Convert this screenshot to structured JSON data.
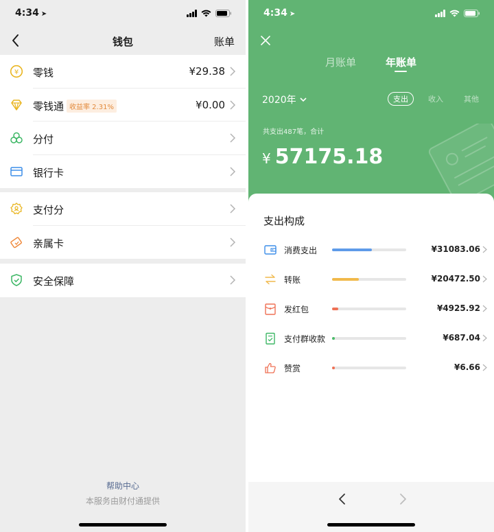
{
  "left": {
    "status": {
      "time": "4:34"
    },
    "header": {
      "title": "钱包",
      "bill": "账单"
    },
    "group1": [
      {
        "label": "零钱",
        "value": "¥29.38"
      },
      {
        "label": "零钱通",
        "badge": "收益率 2.31%",
        "value": "¥0.00"
      },
      {
        "label": "分付",
        "value": ""
      },
      {
        "label": "银行卡",
        "value": ""
      }
    ],
    "group2": [
      {
        "label": "支付分"
      },
      {
        "label": "亲属卡"
      }
    ],
    "group3": [
      {
        "label": "安全保障"
      }
    ],
    "footer": {
      "help": "帮助中心",
      "provider": "本服务由财付通提供"
    },
    "colors": {
      "accent_yellow": "#e9b520",
      "accent_green": "#3db765",
      "accent_blue": "#3c8de8",
      "accent_orange": "#ef8a3c"
    }
  },
  "right": {
    "status": {
      "time": "4:34"
    },
    "tabs": {
      "month": "月账单",
      "year": "年账单"
    },
    "year": "2020年",
    "filters": {
      "expense": "支出",
      "income": "收入",
      "other": "其他"
    },
    "summary": "共支出487笔，合计",
    "total_currency": "¥",
    "total": "57175.18",
    "section_title": "支出构成",
    "categories": [
      {
        "name": "消费支出",
        "amount": "¥31083.06",
        "share": 0.54,
        "color": "#5e9be9",
        "icon": "wallet-icon"
      },
      {
        "name": "转账",
        "amount": "¥20472.50",
        "share": 0.36,
        "color": "#f1b94b",
        "icon": "transfer-icon"
      },
      {
        "name": "发红包",
        "amount": "¥4925.92",
        "share": 0.086,
        "color": "#ef7155",
        "icon": "red-packet-icon"
      },
      {
        "name": "支付群收款",
        "amount": "¥687.04",
        "share": 0.012,
        "color": "#4dbb6a",
        "icon": "group-collect-icon"
      },
      {
        "name": "赞赏",
        "amount": "¥6.66",
        "share": 0.001,
        "color": "#ef7155",
        "icon": "thumb-up-icon"
      }
    ],
    "colors": {
      "header_green": "#61b473"
    }
  }
}
